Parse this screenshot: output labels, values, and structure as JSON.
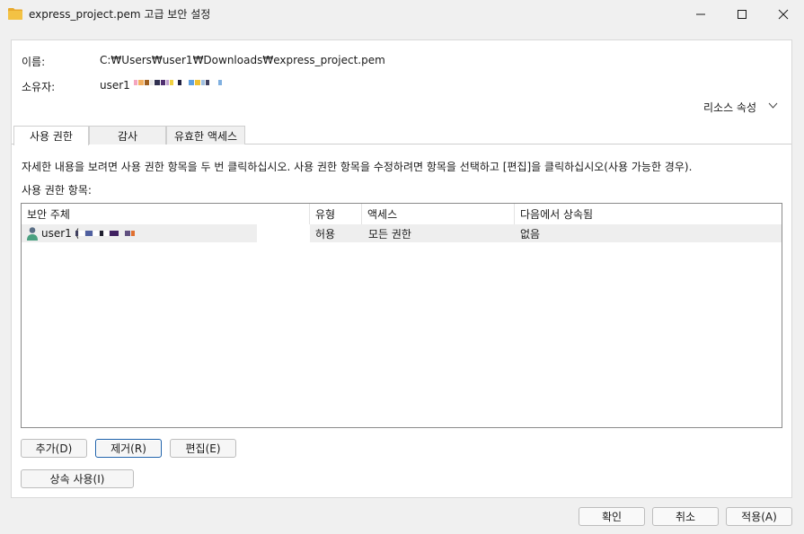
{
  "window": {
    "title": "express_project.pem 고급 보안 설정",
    "minimize_icon": "minimize-icon",
    "maximize_icon": "maximize-icon",
    "close_icon": "close-icon"
  },
  "info": {
    "name_label": "이름:",
    "name_value": "C:₩Users₩user1₩Downloads₩express_project.pem",
    "owner_label": "소유자:",
    "owner_value": "user1"
  },
  "resource_props": {
    "label": "리소스 속성"
  },
  "tabs": [
    {
      "label": "사용 권한"
    },
    {
      "label": "감사"
    },
    {
      "label": "유효한 액세스"
    }
  ],
  "description": "자세한 내용을 보려면 사용 권한 항목을 두 번 클릭하십시오. 사용 권한 항목을 수정하려면 항목을 선택하고 [편집]을 클릭하십시오(사용 가능한 경우).",
  "entries_label": "사용 권한 항목:",
  "table": {
    "columns": [
      "보안 주체",
      "유형",
      "액세스",
      "다음에서 상속됨"
    ],
    "rows": [
      {
        "principal": "user1 (",
        "type": "허용",
        "access": "모든 권한",
        "inherited_from": "없음"
      }
    ]
  },
  "buttons": {
    "add": "추가(D)",
    "remove": "제거(R)",
    "edit": "편집(E)",
    "inheritance": "상속 사용(I)"
  },
  "dialog_buttons": {
    "ok": "확인",
    "cancel": "취소",
    "apply": "적용(A)"
  },
  "colors": {
    "folder": "#f3c244",
    "focus": "#1b5fa8",
    "selected_row": "#eeeeee"
  }
}
